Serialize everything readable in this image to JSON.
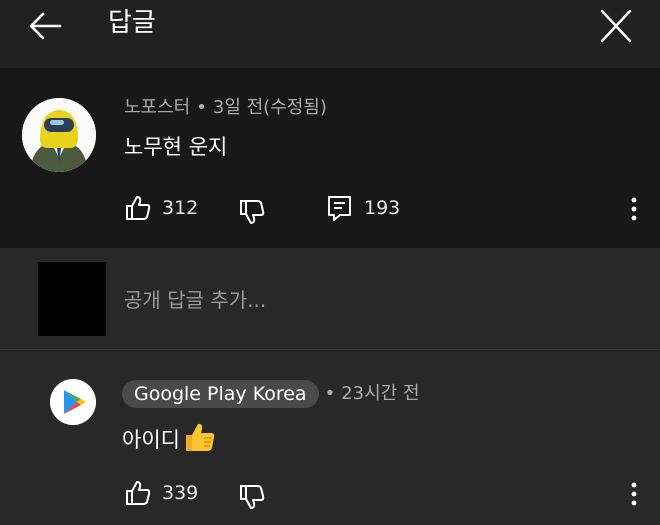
{
  "header": {
    "title": "답글",
    "back_icon": "arrow-left-icon",
    "close_icon": "close-icon"
  },
  "top_comment": {
    "author": "노포스터",
    "separator": "•",
    "time": "3일 전(수정됨)",
    "text": "노무현 운지",
    "likes": "312",
    "replies": "193",
    "avatar_icon": "astronaut-suit-avatar"
  },
  "reply_input": {
    "placeholder": "공개 답글 추가..."
  },
  "reply": {
    "author": "Google Play Korea",
    "separator": "•",
    "time": "23시간 전",
    "text": "아이디",
    "emoji": "thumbs-up-emoji",
    "likes": "339",
    "avatar_icon": "google-play-logo"
  },
  "colors": {
    "background": "#212121",
    "top_comment_bg": "#181818",
    "reply_bg": "#282828",
    "text_primary": "#ffffff",
    "text_secondary": "#aaaaaa",
    "badge_bg": "#4a4a4a"
  }
}
